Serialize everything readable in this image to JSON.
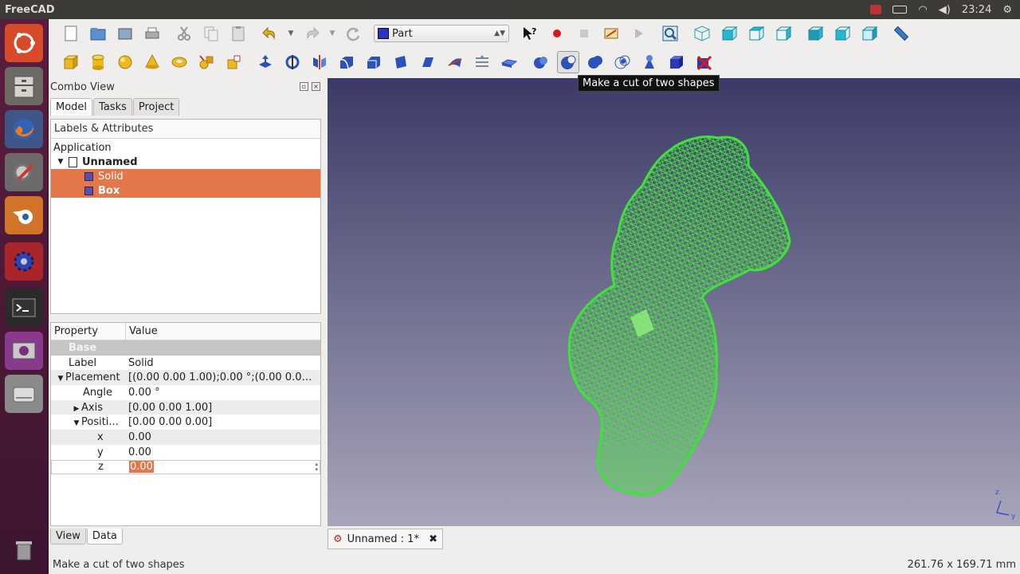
{
  "system": {
    "app_name": "FreeCAD",
    "clock": "23:24"
  },
  "workbench": {
    "selected": "Part"
  },
  "tooltip": "Make a cut of two shapes",
  "combo": {
    "title": "Combo View",
    "tabs": [
      "Model",
      "Tasks",
      "Project"
    ],
    "tree_header": "Labels & Attributes",
    "tree": {
      "root": "Application",
      "document": "Unnamed",
      "items": [
        "Solid",
        "Box"
      ]
    },
    "properties": {
      "col_property": "Property",
      "col_value": "Value",
      "group": "Base",
      "rows": [
        {
          "key": "Label",
          "value": "Solid"
        },
        {
          "key": "Placement",
          "value": "[(0.00 0.00 1.00);0.00 °;(0.00 0.00 0...."
        },
        {
          "key": "Angle",
          "value": "0.00 °"
        },
        {
          "key": "Axis",
          "value": "[0.00 0.00 1.00]"
        },
        {
          "key": "Positi...",
          "value": "[0.00 0.00 0.00]"
        },
        {
          "key": "x",
          "value": "0.00"
        },
        {
          "key": "y",
          "value": "0.00"
        },
        {
          "key": "z",
          "value": "0.00"
        }
      ]
    },
    "bottom_tabs": [
      "View",
      "Data"
    ]
  },
  "doc_tab": {
    "label": "Unnamed : 1*"
  },
  "status": {
    "message": "Make a cut of two shapes",
    "dimensions": "261.76 x 169.71 mm"
  },
  "colors": {
    "selection": "#e4774a",
    "mesh": "#3fe23a",
    "view_top": "#3b3a67",
    "view_bottom": "#a7a6b9"
  }
}
